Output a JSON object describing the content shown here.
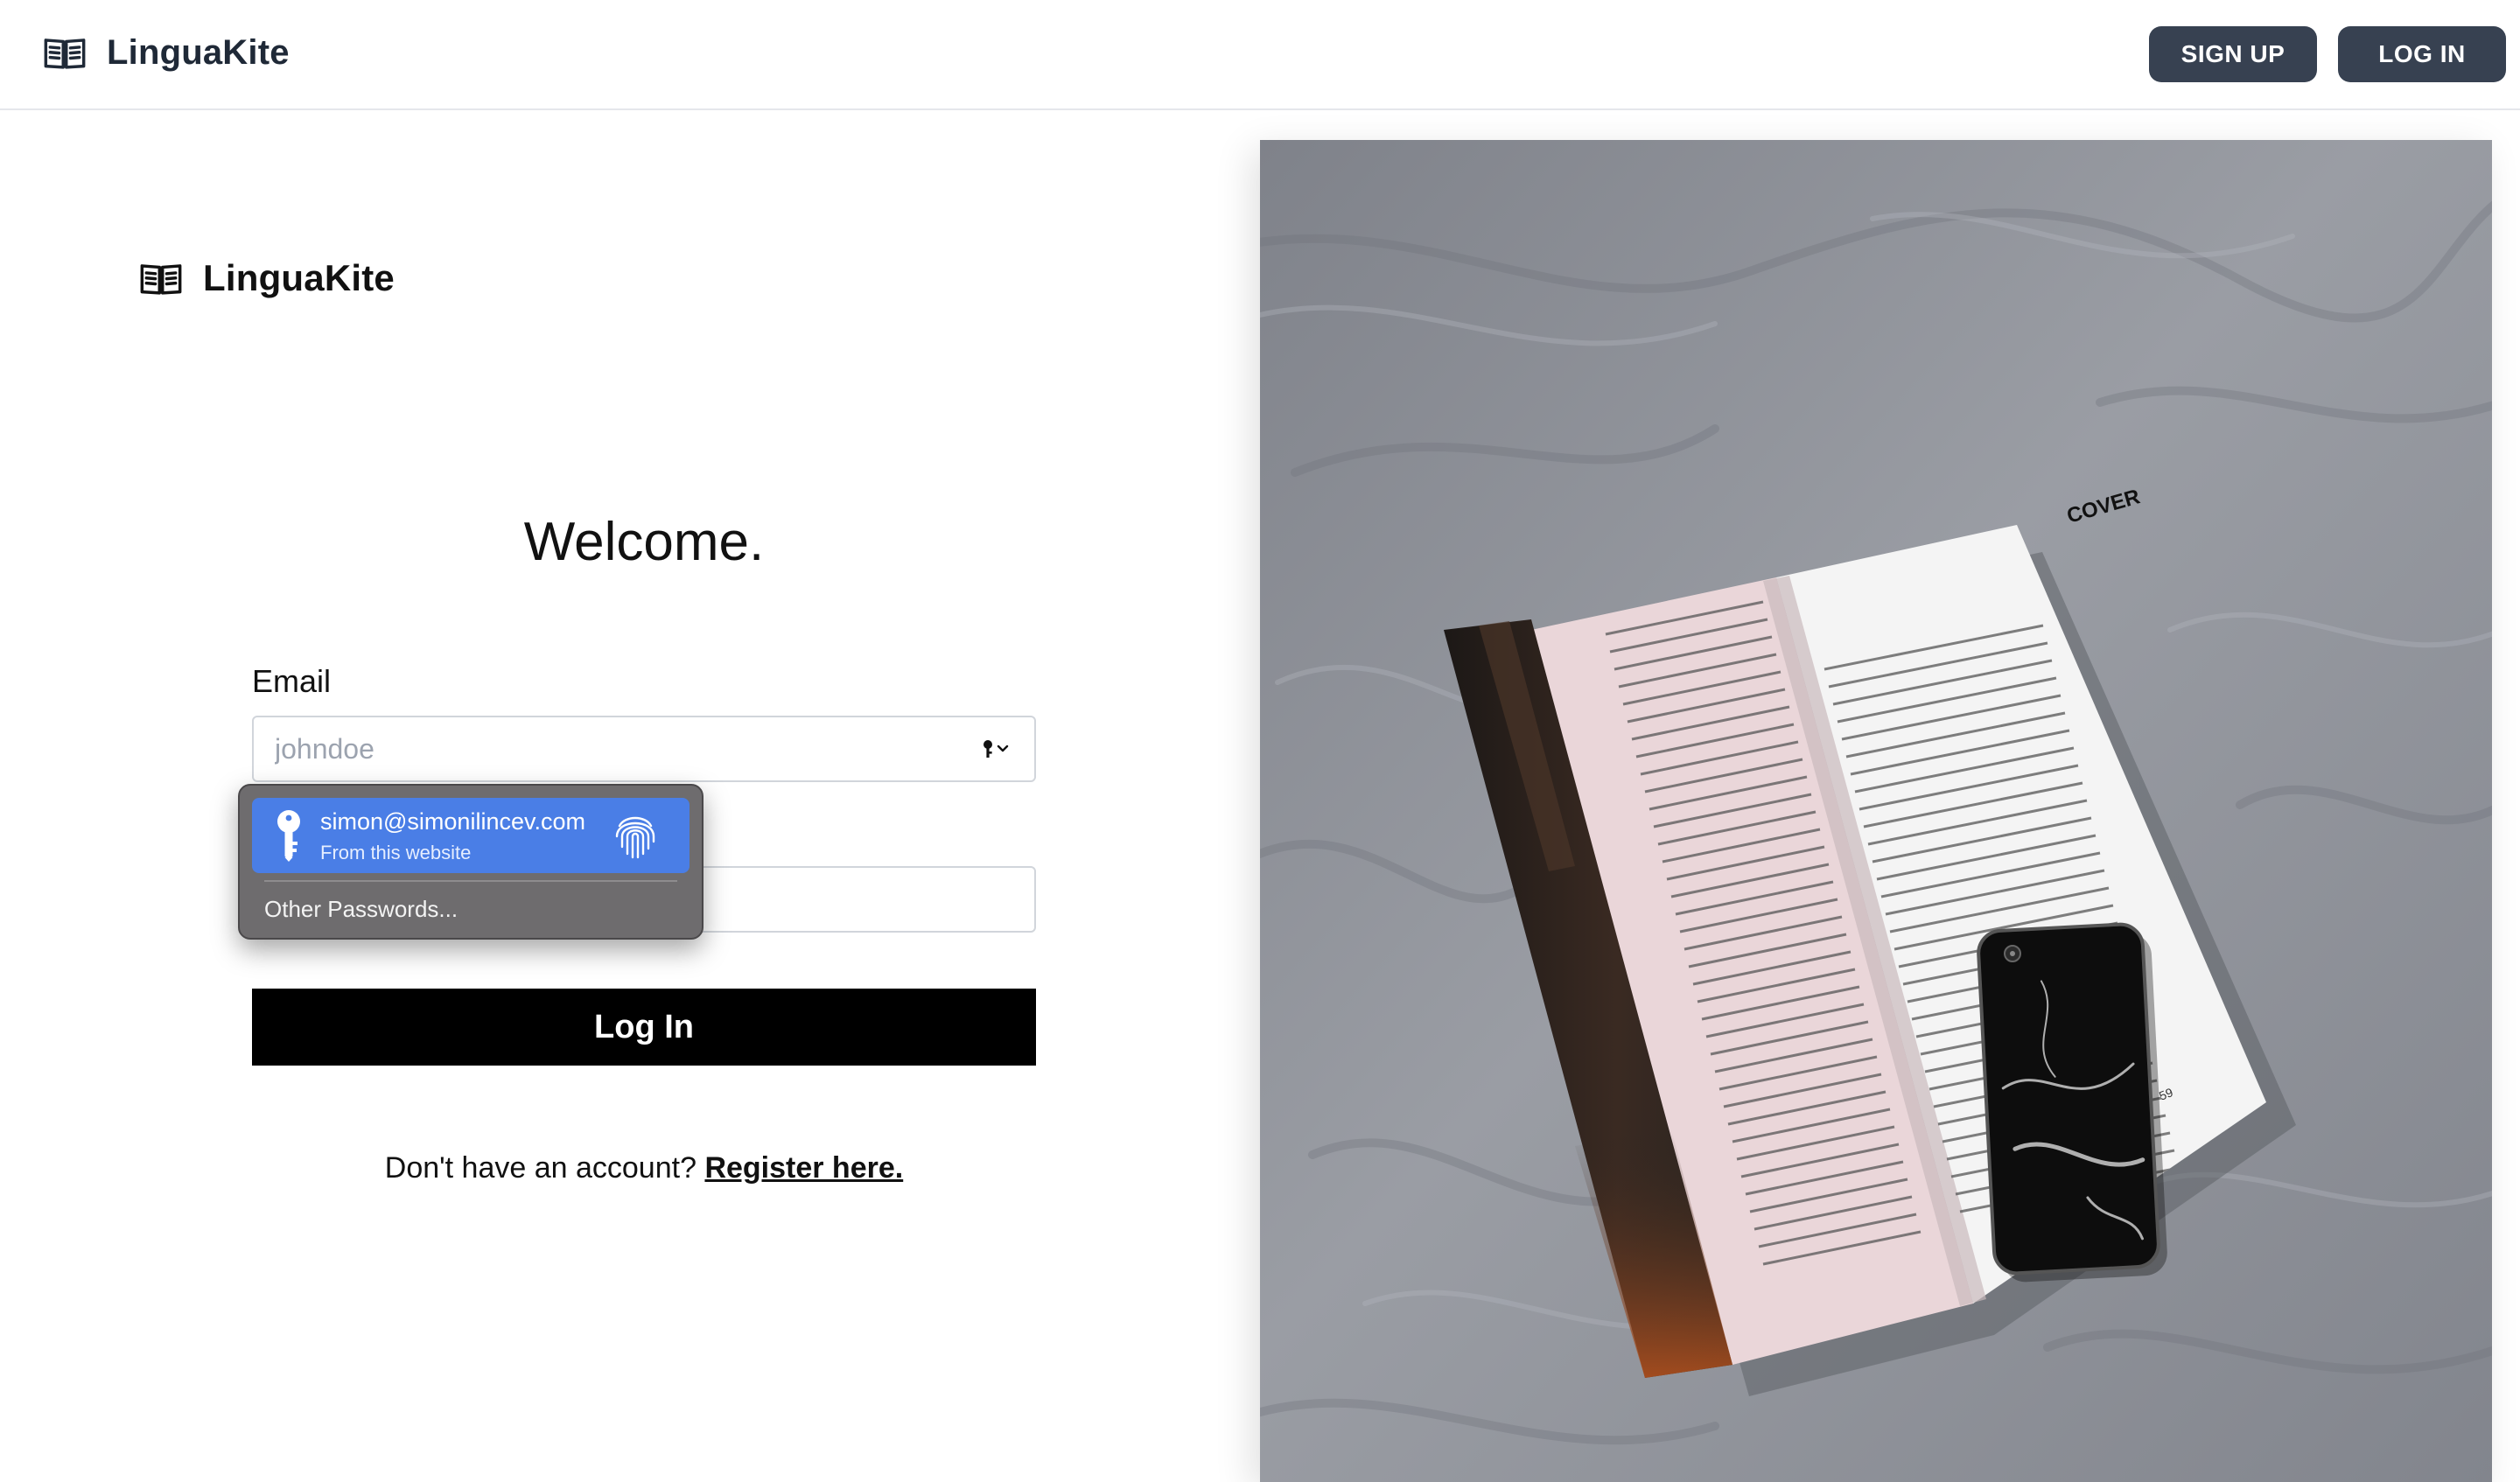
{
  "header": {
    "brand_icon": "open-book-icon",
    "brand_name": "LinguaKite",
    "signup_label": "SIGN UP",
    "login_label": "LOG IN"
  },
  "login": {
    "brand_icon": "open-book-icon",
    "brand_name": "LinguaKite",
    "welcome": "Welcome.",
    "email_label": "Email",
    "email_placeholder": "johndoe",
    "submit_label": "Log In",
    "register_prompt": "Don't have an account?",
    "register_link": "Register here."
  },
  "autofill": {
    "key_icon": "key-icon",
    "username": "simon@simonilincev.com",
    "source": "From this website",
    "fingerprint_icon": "fingerprint-icon",
    "other_label": "Other Passwords..."
  },
  "hero": {
    "description_icon": "magazine-and-phone-photo",
    "magazine_heading": "COVER",
    "page_number": "59"
  },
  "colors": {
    "header_button_bg": "#374151",
    "primary_button_bg": "#000000",
    "autofill_bg": "#6e6c6e",
    "autofill_selected": "#4a7ee6",
    "sheet_gray": "#8d9098"
  }
}
